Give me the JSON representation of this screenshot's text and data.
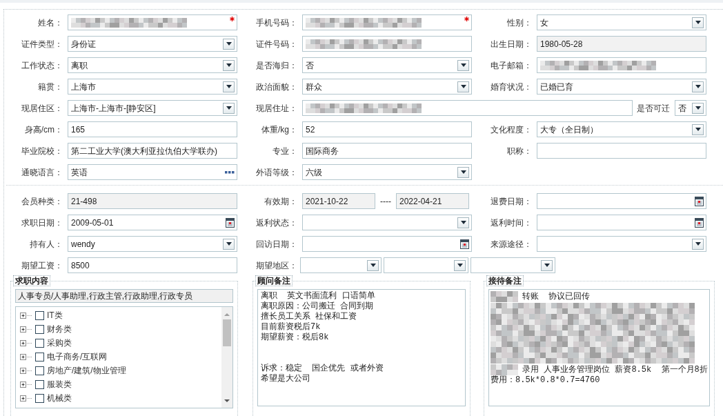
{
  "basic_info": {
    "rows": [
      {
        "fields": [
          {
            "label": "姓名：",
            "kind": "text",
            "readonly": false,
            "required": true,
            "redacted": true
          },
          {
            "label": "手机号码：",
            "kind": "text",
            "readonly": false,
            "required": true,
            "redacted": true
          },
          {
            "label": "性别：",
            "kind": "select",
            "value": "女",
            "readonly": false,
            "required": false,
            "redacted": false
          }
        ]
      },
      {
        "fields": [
          {
            "label": "证件类型：",
            "kind": "select",
            "value": "身份证",
            "readonly": false,
            "required": false,
            "redacted": false
          },
          {
            "label": "证件号码：",
            "kind": "text",
            "readonly": false,
            "required": false,
            "redacted": true
          },
          {
            "label": "出生日期：",
            "kind": "text",
            "value": "1980-05-28",
            "readonly": true,
            "required": false,
            "redacted": false
          }
        ]
      },
      {
        "fields": [
          {
            "label": "工作状态：",
            "kind": "select",
            "value": "离职",
            "readonly": false,
            "required": false,
            "redacted": false
          },
          {
            "label": "是否海归：",
            "kind": "select",
            "value": "否",
            "readonly": false,
            "required": false,
            "redacted": false
          },
          {
            "label": "电子邮箱：",
            "kind": "text",
            "readonly": false,
            "required": false,
            "redacted": true
          }
        ]
      },
      {
        "fields": [
          {
            "label": "籍贯：",
            "kind": "select",
            "value": "上海市",
            "readonly": false,
            "required": false,
            "redacted": false
          },
          {
            "label": "政治面貌：",
            "kind": "select",
            "value": "群众",
            "readonly": false,
            "required": false,
            "redacted": false
          },
          {
            "label": "婚育状况：",
            "kind": "select",
            "value": "已婚已育",
            "readonly": false,
            "required": false,
            "redacted": false
          }
        ]
      },
      {
        "fields": [
          {
            "label": "现居住区：",
            "kind": "select",
            "value": "上海市-上海市-[静安区]",
            "readonly": false,
            "required": false,
            "redacted": false
          },
          {
            "label": "现居住址：",
            "kind": "text",
            "wide": true,
            "readonly": false,
            "required": false,
            "redacted": true
          },
          {
            "label": "是否可迁",
            "kind": "select",
            "compact": true,
            "value": "否",
            "readonly": false,
            "required": false,
            "redacted": false
          }
        ]
      },
      {
        "fields": [
          {
            "label": "身高/cm：",
            "kind": "text",
            "value": "165",
            "readonly": false,
            "required": false,
            "redacted": false
          },
          {
            "label": "体重/kg：",
            "kind": "text",
            "value": "52",
            "readonly": false,
            "required": false,
            "redacted": false
          },
          {
            "label": "文化程度：",
            "kind": "select",
            "value": "大专（全日制）",
            "readonly": false,
            "required": false,
            "redacted": false
          }
        ]
      },
      {
        "fields": [
          {
            "label": "毕业院校：",
            "kind": "text",
            "value": "第二工业大学(澳大利亚拉仇伯大学联办)",
            "readonly": false,
            "required": false,
            "redacted": false
          },
          {
            "label": "专业：",
            "kind": "text",
            "value": "国际商务",
            "readonly": false,
            "required": false,
            "redacted": false
          },
          {
            "label": "职称：",
            "kind": "text",
            "readonly": false,
            "required": false,
            "redacted": false
          }
        ]
      },
      {
        "fields": [
          {
            "label": "通晓语言：",
            "kind": "lookup",
            "value": "英语",
            "readonly": false,
            "required": false,
            "redacted": false
          },
          {
            "label": "外语等级：",
            "kind": "select",
            "value": "六级",
            "readonly": false,
            "required": false,
            "redacted": false
          }
        ]
      }
    ]
  },
  "membership": {
    "rows": [
      {
        "fields": [
          {
            "label": "会员种类：",
            "kind": "text",
            "value": "21-498",
            "readonly": true,
            "required": false,
            "redacted": false
          },
          {
            "label": "有效期：",
            "kind": "range",
            "values": [
              "2021-10-22",
              "2022-04-21"
            ],
            "separator": "----",
            "readonly": true,
            "required": false,
            "redacted": false
          },
          {
            "label": "退费日期：",
            "kind": "date",
            "readonly": false,
            "required": false,
            "redacted": false
          }
        ]
      },
      {
        "fields": [
          {
            "label": "求职日期：",
            "kind": "date",
            "value": "2009-05-01",
            "readonly": false,
            "required": false,
            "redacted": false
          },
          {
            "label": "返利状态：",
            "kind": "select",
            "readonly": false,
            "required": false,
            "redacted": false
          },
          {
            "label": "返利时间：",
            "kind": "date",
            "readonly": false,
            "required": false,
            "redacted": false
          }
        ]
      },
      {
        "fields": [
          {
            "label": "持有人：",
            "kind": "select",
            "value": "wendy",
            "readonly": false,
            "required": false,
            "redacted": false
          },
          {
            "label": "回访日期：",
            "kind": "date",
            "readonly": false,
            "required": false,
            "redacted": false
          },
          {
            "label": "来源途径：",
            "kind": "select",
            "readonly": false,
            "required": false,
            "redacted": false
          }
        ]
      },
      {
        "fields": [
          {
            "label": "期望工资：",
            "kind": "text",
            "value": "8500",
            "readonly": false,
            "required": false,
            "redacted": false
          },
          {
            "label": "期望地区：",
            "kind": "multi",
            "parts": [
              {
                "kind": "select"
              },
              {
                "kind": "select"
              },
              {
                "kind": "select"
              }
            ],
            "readonly": false,
            "required": false,
            "redacted": false
          }
        ]
      }
    ]
  },
  "job_intent": {
    "title": "求职内容",
    "summary": "人事专员/人事助理,行政主管,行政助理,行政专员",
    "categories": [
      {
        "label": "IT类",
        "expanded": false,
        "checked": false
      },
      {
        "label": "财务类",
        "expanded": false,
        "checked": false
      },
      {
        "label": "采购类",
        "expanded": false,
        "checked": false
      },
      {
        "label": "电子商务/互联网",
        "expanded": false,
        "checked": false
      },
      {
        "label": "房地产/建筑/物业管理",
        "expanded": false,
        "checked": false
      },
      {
        "label": "服装类",
        "expanded": false,
        "checked": false
      },
      {
        "label": "机械类",
        "expanded": false,
        "checked": false
      }
    ]
  },
  "consultant_notes": {
    "title": "顾问备注",
    "lines": [
      {
        "kind": "text",
        "text": "离职  英文书面流利 口语简单"
      },
      {
        "kind": "text",
        "text": "离职原因：公司搬迁 合同到期"
      },
      {
        "kind": "text",
        "text": "擅长员工关系 社保和工资"
      },
      {
        "kind": "text",
        "text": "目前薪资税后7k"
      },
      {
        "kind": "text",
        "text": "期望薪资：税后8k"
      },
      {
        "kind": "blank"
      },
      {
        "kind": "blank"
      },
      {
        "kind": "text",
        "text": "诉求：稳定  国企优先 或者外资"
      },
      {
        "kind": "text",
        "text": "希望是大公司"
      }
    ]
  },
  "reception_notes": {
    "title": "接待备注",
    "lines": [
      {
        "kind": "text",
        "redacted_prefix": true,
        "text": "转账  协议已回传"
      },
      {
        "kind": "redacted"
      },
      {
        "kind": "text",
        "redacted_prefix": true,
        "text": "录用 人事业务管理岗位 薪资8.5k  第一个月8折"
      },
      {
        "kind": "text",
        "redacted_prefix": false,
        "text": "费用：8.5k*0.8*0.7=4760"
      }
    ]
  }
}
